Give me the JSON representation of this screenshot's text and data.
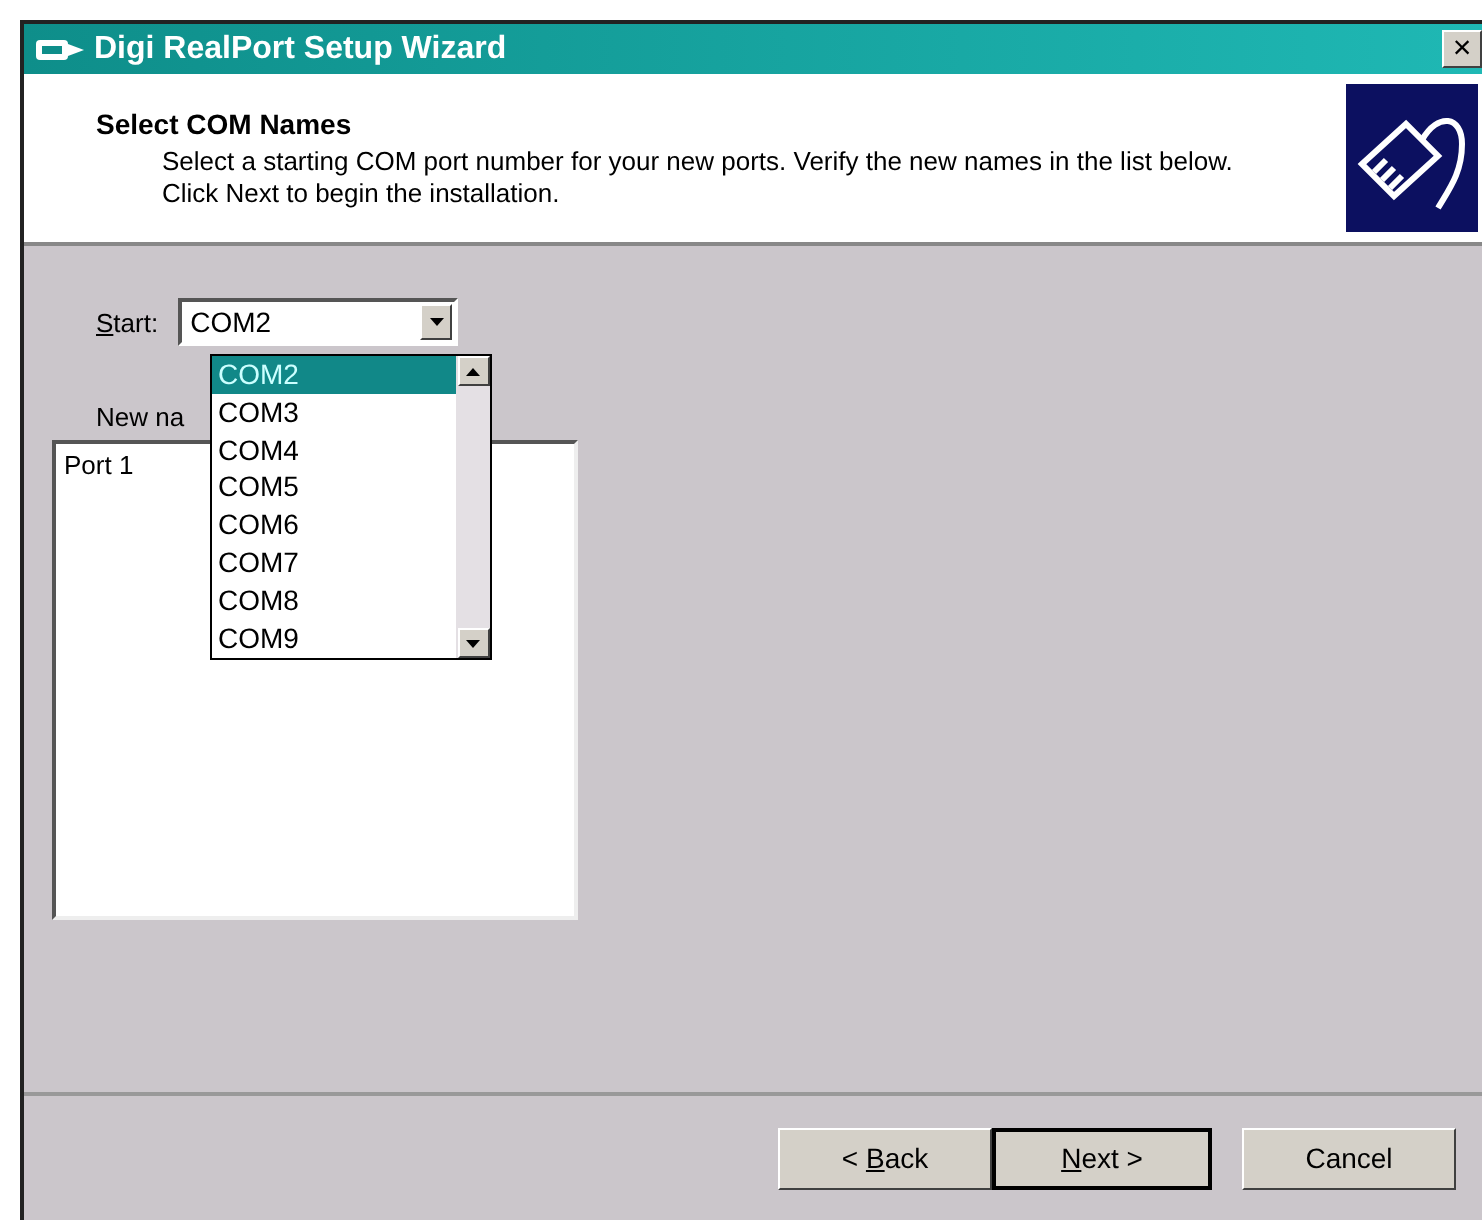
{
  "window": {
    "title": "Digi RealPort Setup Wizard",
    "close": "×"
  },
  "header": {
    "title": "Select COM Names",
    "description": "Select a starting COM port number for your new ports. Verify the new names in the list below.  Click Next to begin the installation."
  },
  "start": {
    "label": "Start:",
    "mnemonic": true,
    "value": "COM2",
    "expanded": true,
    "options": [
      {
        "label": "COM2",
        "selected": true
      },
      {
        "label": "COM3",
        "selected": false
      },
      {
        "label": "COM4",
        "selected": false
      },
      {
        "label": "COM5",
        "selected": false
      },
      {
        "label": "COM6",
        "selected": false
      },
      {
        "label": "COM7",
        "selected": false
      },
      {
        "label": "COM8",
        "selected": false
      },
      {
        "label": "COM9",
        "selected": false
      }
    ]
  },
  "new_names": {
    "label": "New na",
    "items": [
      "Port 1"
    ]
  },
  "buttons": [
    {
      "label": "< Back",
      "mnemonic": true,
      "default": false
    },
    {
      "label": "Next >",
      "mnemonic": true,
      "default": true
    },
    {
      "label": "Cancel",
      "mnemonic": false,
      "default": false
    }
  ]
}
